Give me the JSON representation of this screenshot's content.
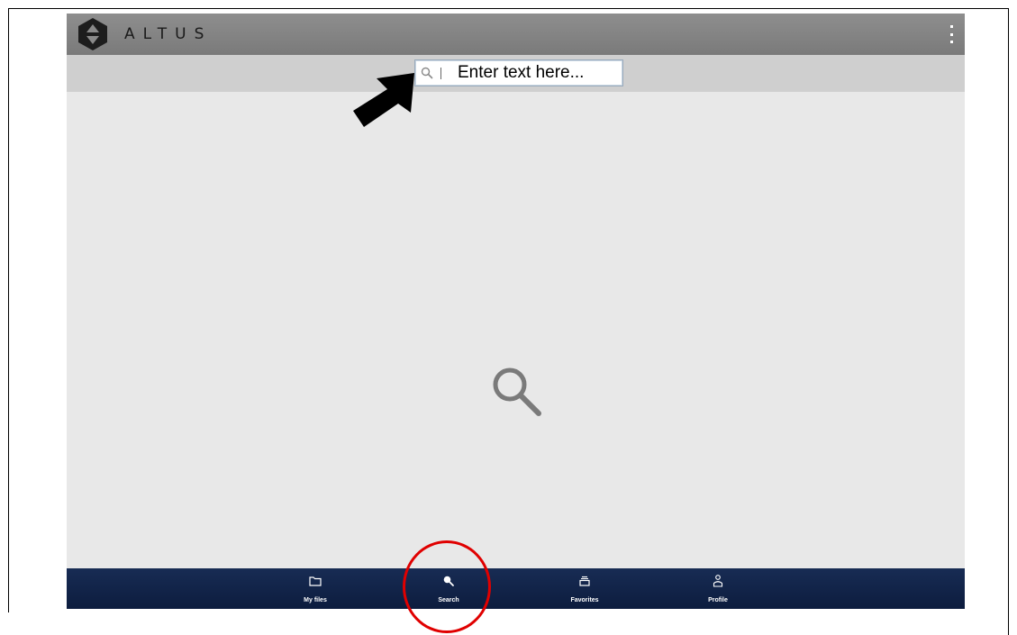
{
  "app": {
    "brand": "ALTUS",
    "menu_icon": "kebab-menu-icon"
  },
  "search": {
    "placeholder": "Enter text here...",
    "value": "",
    "icon": "search-icon"
  },
  "content": {
    "empty_state_icon": "search-icon"
  },
  "bottom_nav": {
    "items": [
      {
        "label": "My files",
        "icon": "folder-icon"
      },
      {
        "label": "Search",
        "icon": "search-icon",
        "active": true
      },
      {
        "label": "Favorites",
        "icon": "tray-icon"
      },
      {
        "label": "Profile",
        "icon": "user-icon"
      }
    ]
  },
  "annotations": {
    "arrow_color": "#000000",
    "circle_color": "#e00000"
  },
  "colors": {
    "topbar": "#858585",
    "searchbar": "#cfcfcf",
    "content_bg": "#e8e8e8",
    "bottom_nav": "#122447"
  }
}
